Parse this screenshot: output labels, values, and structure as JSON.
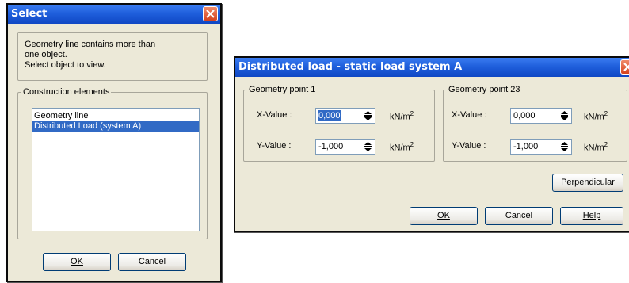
{
  "select_dialog": {
    "title": "Select",
    "message_lines": [
      "Geometry line contains more than",
      "one object.",
      "Select object to view."
    ],
    "group_label": "Construction elements",
    "list_items": [
      {
        "label": "Geometry line",
        "selected": false
      },
      {
        "label": "Distributed Load (system A)",
        "selected": true
      }
    ],
    "ok_label": "OK",
    "cancel_label": "Cancel"
  },
  "load_dialog": {
    "title": "Distributed load - static load system A",
    "point1": {
      "legend": "Geometry point 1",
      "x_label": "X-Value :",
      "x_value": "0,000",
      "y_label": "Y-Value :",
      "y_value": "-1,000"
    },
    "point2": {
      "legend": "Geometry point 23",
      "x_label": "X-Value :",
      "x_value": "0,000",
      "y_label": "Y-Value :",
      "y_value": "-1,000"
    },
    "unit_base": "kN/m",
    "unit_exp": "2",
    "perpendicular_label": "Perpendicular",
    "ok_label": "OK",
    "cancel_label": "Cancel",
    "help_label": "Help"
  },
  "colors": {
    "titlebar": "#1f5fdc",
    "selection": "#316ac5",
    "window_bg": "#ece9d8",
    "close_button": "#d6431e"
  },
  "icons": [
    "close-icon",
    "spinner-arrows-icon"
  ]
}
